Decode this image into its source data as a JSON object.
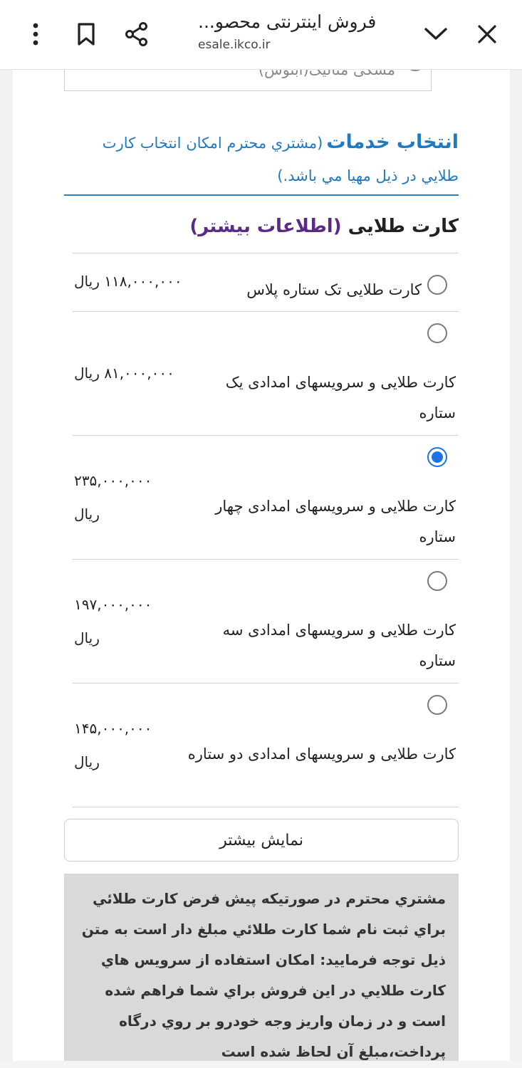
{
  "browser": {
    "title": "فروش اینترنتی محصو...",
    "url": "esale.ikco.ir",
    "icons": [
      "close-icon",
      "chevron-down-icon",
      "share-icon",
      "bookmark-icon",
      "more-vert-icon"
    ]
  },
  "color_option": {
    "label": "مشکی متالیک(ابنوس)"
  },
  "services": {
    "heading": "انتخاب خدمات",
    "subtitle": "(مشتري محترم امكان انتخاب كارت طلايي در ذيل مهيا مي باشد.)"
  },
  "gold_card": {
    "title": "کارت طلایی",
    "more_info": "(اطلاعات بیشتر)",
    "options": [
      {
        "name": "کارت طلایی تک ستاره پلاس",
        "price": "۱۱۸,۰۰۰,۰۰۰ ریال",
        "selected": false
      },
      {
        "name": "کارت طلایی و سرویسهای امدادی یک ستاره",
        "price": "۸۱,۰۰۰,۰۰۰ ریال",
        "selected": false
      },
      {
        "name": "کارت طلایی و سرویسهای امدادی چهار ستاره",
        "price": "۲۳۵,۰۰۰,۰۰۰ ریال",
        "selected": true
      },
      {
        "name": "کارت طلایی و سرویسهای امدادی سه ستاره",
        "price": "۱۹۷,۰۰۰,۰۰۰ ریال",
        "selected": false
      },
      {
        "name": "کارت طلایی و سرویسهای امدادی دو ستاره",
        "price": "۱۴۵,۰۰۰,۰۰۰ ریال",
        "selected": false
      }
    ],
    "show_more": "نمایش بیشتر"
  },
  "notice": {
    "text": "مشتري محترم در صورتيكه پيش فرض كارت طلائي براي ثبت نام شما كارت طلائي مبلغ دار است به متن ذيل توجه فرماييد: امكان استفاده از سرويس هاي كارت طلايي در اين فروش براي شما فراهم شده است و در زمان واريز وجه خودرو بر روي درگاه پرداخت،مبلغ آن لحاظ شده است"
  },
  "colors": {
    "accent": "#1f7ac1",
    "radio_selected": "#1a73e8",
    "more_info": "#5b2a86",
    "notice_bg": "#d9d9d9"
  }
}
